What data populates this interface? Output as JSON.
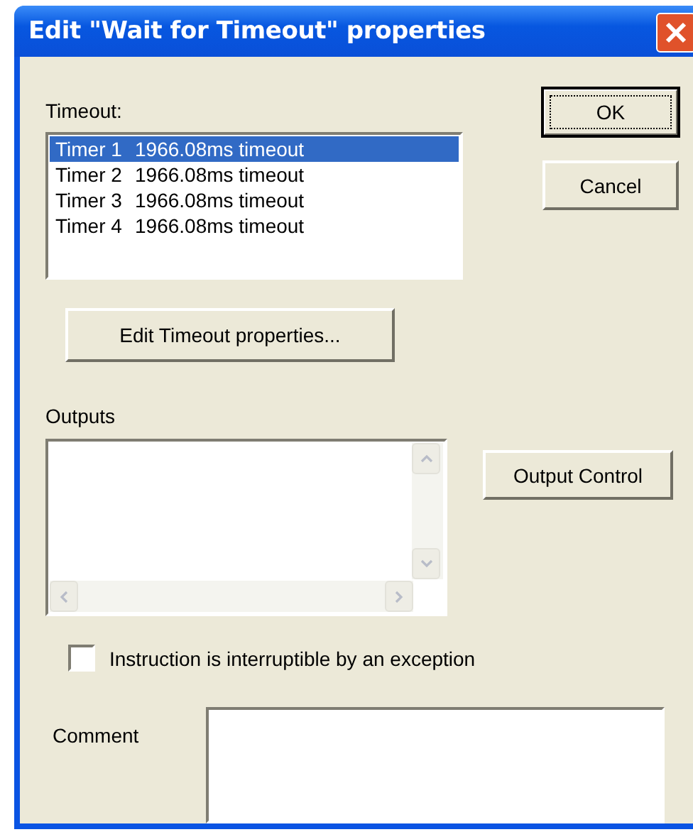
{
  "window": {
    "title": "Edit \"Wait for Timeout\" properties"
  },
  "timeout": {
    "label": "Timeout:",
    "items": [
      {
        "name": "Timer 1",
        "value": "1966.08ms timeout",
        "selected": true
      },
      {
        "name": "Timer 2",
        "value": "1966.08ms timeout",
        "selected": false
      },
      {
        "name": "Timer 3",
        "value": "1966.08ms timeout",
        "selected": false
      },
      {
        "name": "Timer 4",
        "value": "1966.08ms timeout",
        "selected": false
      }
    ]
  },
  "buttons": {
    "ok": "OK",
    "cancel": "Cancel",
    "edit_timeout": "Edit Timeout properties...",
    "output_control": "Output Control"
  },
  "outputs": {
    "label": "Outputs"
  },
  "interruptible": {
    "label": "Instruction is interruptible by an exception",
    "checked": false
  },
  "comment": {
    "label": "Comment"
  }
}
